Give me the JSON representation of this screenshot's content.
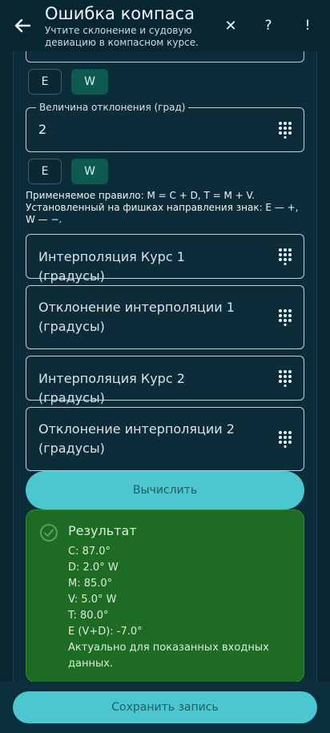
{
  "header": {
    "title": "Ошибка компаса",
    "subtitle": "Учтите склонение и судовую девиацию в компасном курсе.",
    "back_icon": "arrow-left-icon",
    "close_label": "✕",
    "help_label": "?",
    "alert_label": "!"
  },
  "toggles_1": {
    "east": "E",
    "west": "W",
    "selected": "W"
  },
  "deviation_field": {
    "label": "Величина отклонения (град)",
    "value": "2",
    "icon": "keypad-icon"
  },
  "toggles_2": {
    "east": "E",
    "west": "W",
    "selected": "W"
  },
  "rule": {
    "line1": "Применяемое правило: M = C + D, T = M + V.",
    "line2": "Установленный на фишках направления знак: E — +, W — −."
  },
  "fields": {
    "interp_course_1": "Интерполяция Курс 1 (градусы)",
    "interp_dev_1": "Отклонение интерполяции 1 (градусы)",
    "interp_course_2": "Интерполяция Курс 2 (градусы)",
    "interp_dev_2": "Отклонение интерполяции 2 (градусы)"
  },
  "calculate_label": "Вычислить",
  "result": {
    "title": "Результат",
    "lines": [
      "C: 87.0°",
      "D: 2.0° W",
      "M: 85.0°",
      "V: 5.0° W",
      "T: 80.0°",
      "E (V+D): -7.0°",
      "Актуально для показанных входных данных."
    ]
  },
  "save_label": "Сохранить запись",
  "colors": {
    "background": "#0a2430",
    "accent": "#4cc6cf",
    "selected_toggle": "#0f5a50",
    "result_bg": "#1e6b24"
  }
}
